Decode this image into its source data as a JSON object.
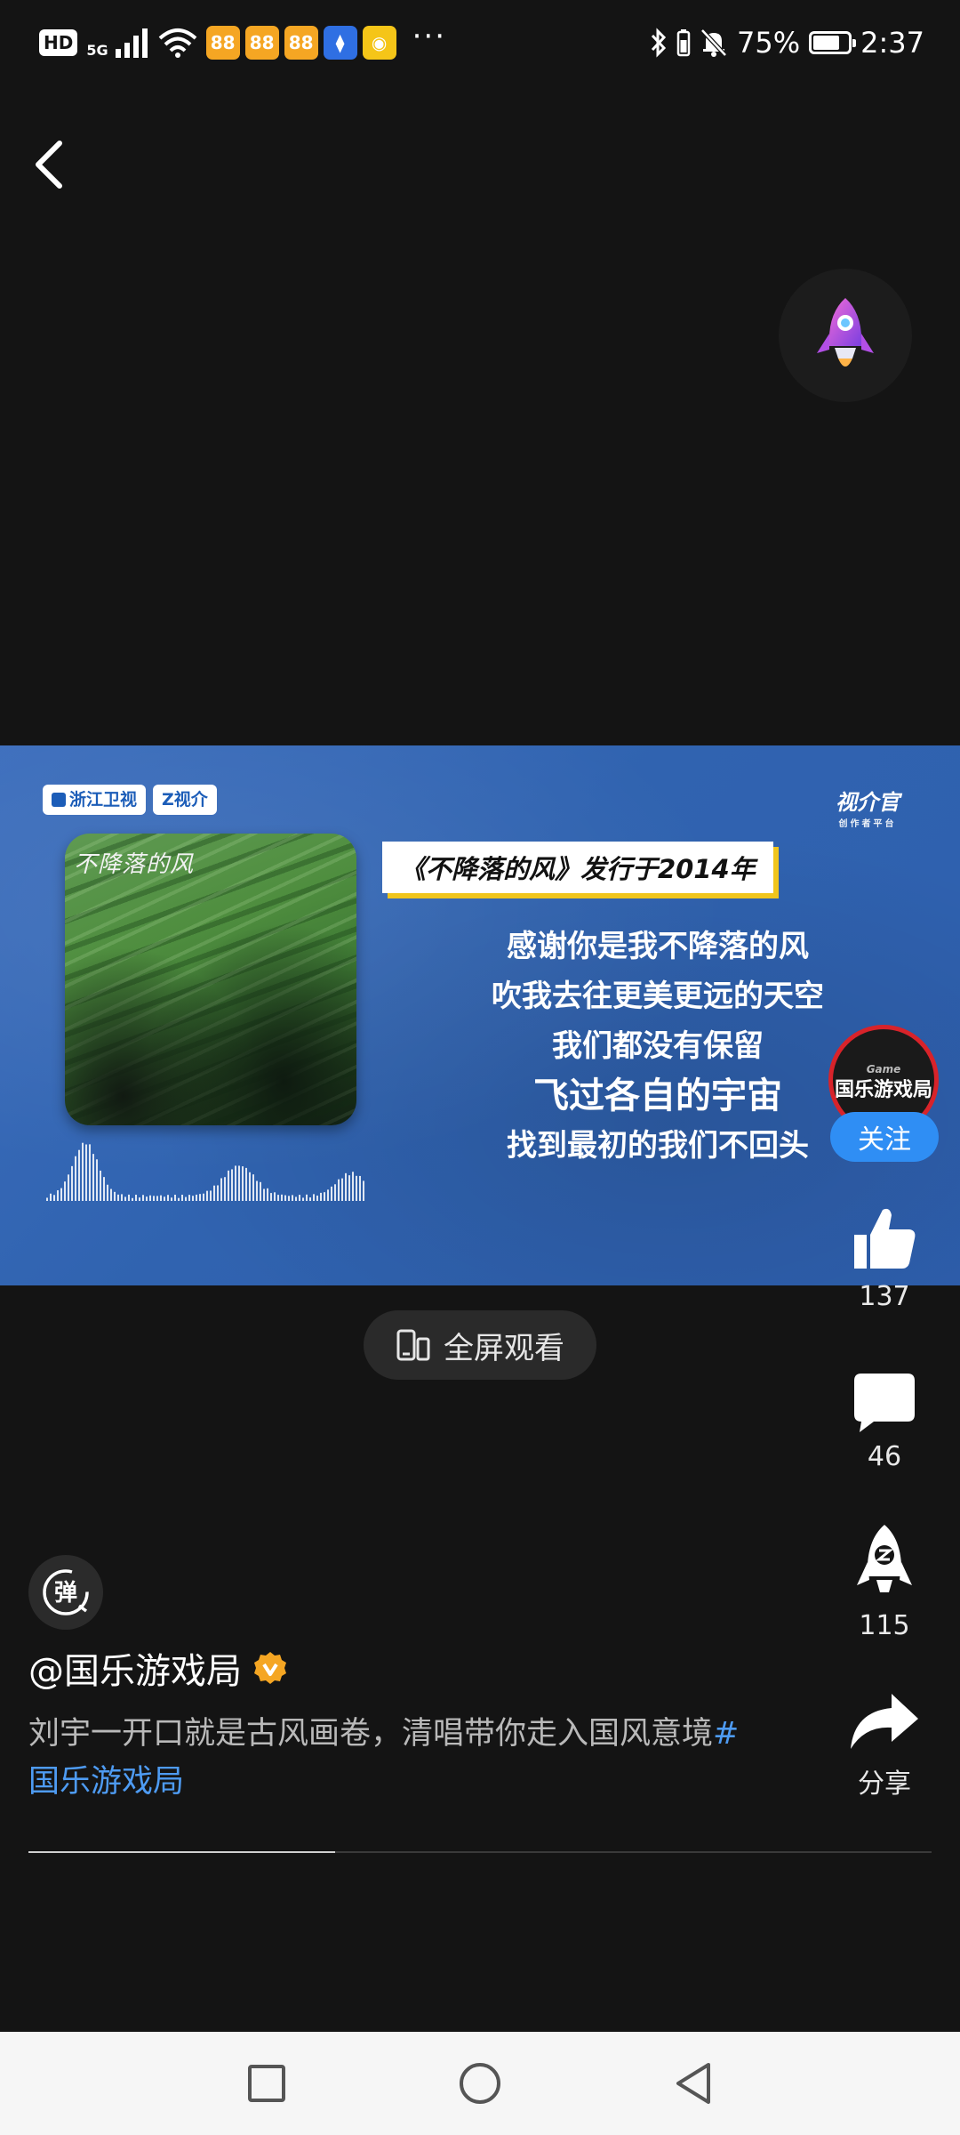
{
  "status_bar": {
    "hd_label": "HD",
    "network_label": "5G",
    "app_icons": [
      {
        "name": "app-notification-icon",
        "label": "88",
        "color": "#f5a623"
      },
      {
        "name": "app-notification-icon",
        "label": "88",
        "color": "#f5a623"
      },
      {
        "name": "app-notification-icon",
        "label": "88",
        "color": "#f5a623"
      },
      {
        "name": "app-notification-icon",
        "label": "⧫",
        "color": "#2f6fe3"
      },
      {
        "name": "weibo-icon",
        "label": "◉",
        "color": "#f5c518"
      }
    ],
    "more_label": "···",
    "battery_percent": "75%",
    "battery_level": 0.75,
    "time": "2:37"
  },
  "video": {
    "broadcasters": [
      "浙江卫视",
      "Z视介"
    ],
    "platform_logo": "视介官",
    "platform_sub": "创作者平台",
    "album_title": "不降落的风",
    "banner": "《不降落的风》发行于2014年",
    "lyrics": [
      "感谢你是我不降落的风",
      "吹我去往更美更远的天空",
      "我们都没有保留",
      "飞过各自的宇宙",
      "找到最初的我们不回头"
    ]
  },
  "creator": {
    "avatar_text": "国乐游戏局",
    "avatar_sub": "Game",
    "follow_label": "关注"
  },
  "actions": {
    "like_count": "137",
    "comment_count": "46",
    "boost_count": "115",
    "share_label": "分享"
  },
  "fullscreen": {
    "label": "全屏观看"
  },
  "post": {
    "danmaku_label": "弹",
    "author": "@国乐游戏局",
    "caption_text": "刘宇一开口就是古风画卷，清唱带你走入国风意境",
    "hashtag": "#国乐游戏局",
    "progress": 0.34
  },
  "colors": {
    "background": "#141414",
    "accent_blue": "#2f8ef4",
    "hashtag_blue": "#4e9bf2",
    "video_blue": "#3567b4",
    "verified_orange": "#f5a623"
  }
}
